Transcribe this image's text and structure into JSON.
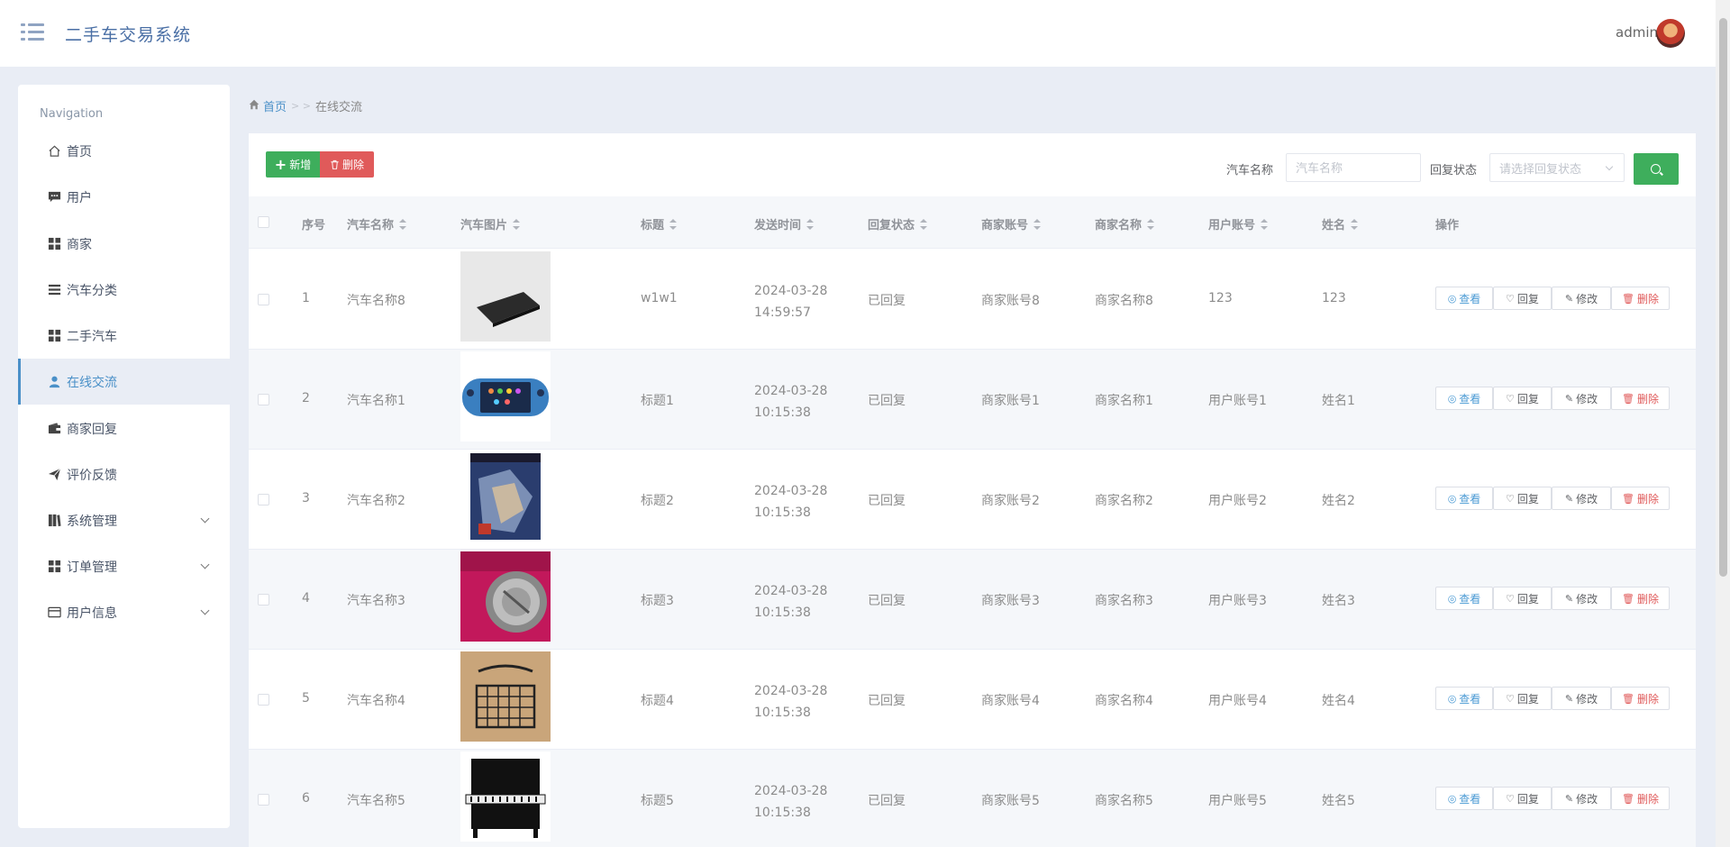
{
  "header": {
    "app_title": "二手车交易系统",
    "user_name": "admin"
  },
  "sidebar": {
    "heading": "Navigation",
    "items": [
      {
        "label": "首页",
        "icon": "home-icon"
      },
      {
        "label": "用户",
        "icon": "chat-icon"
      },
      {
        "label": "商家",
        "icon": "grid-icon"
      },
      {
        "label": "汽车分类",
        "icon": "list-icon"
      },
      {
        "label": "二手汽车",
        "icon": "grid-icon"
      },
      {
        "label": "在线交流",
        "icon": "user-icon",
        "active": true
      },
      {
        "label": "商家回复",
        "icon": "wallet-icon"
      },
      {
        "label": "评价反馈",
        "icon": "send-icon"
      },
      {
        "label": "系统管理",
        "icon": "book-icon",
        "expandable": true
      },
      {
        "label": "订单管理",
        "icon": "grid-icon",
        "expandable": true
      },
      {
        "label": "用户信息",
        "icon": "card-icon",
        "expandable": true
      }
    ]
  },
  "breadcrumb": {
    "home": "首页",
    "separator": "> >",
    "current": "在线交流"
  },
  "toolbar": {
    "add_label": "新增",
    "delete_label": "删除"
  },
  "search": {
    "car_name_label": "汽车名称",
    "car_name_placeholder": "汽车名称",
    "reply_status_label": "回复状态",
    "reply_status_placeholder": "请选择回复状态"
  },
  "table": {
    "columns": [
      "序号",
      "汽车名称",
      "汽车图片",
      "标题",
      "发送时间",
      "回复状态",
      "商家账号",
      "商家名称",
      "用户账号",
      "姓名",
      "操作"
    ],
    "rows": [
      {
        "no": "1",
        "car_name": "汽车名称8",
        "image": "laptop",
        "title": "w1w1",
        "time": "2024-03-28 14:59:57",
        "status": "已回复",
        "merchant_account": "商家账号8",
        "merchant_name": "商家名称8",
        "user_account": "123",
        "name": "123"
      },
      {
        "no": "2",
        "car_name": "汽车名称1",
        "image": "game-console",
        "title": "标题1",
        "time": "2024-03-28 10:15:38",
        "status": "已回复",
        "merchant_account": "商家账号1",
        "merchant_name": "商家名称1",
        "user_account": "用户账号1",
        "name": "姓名1"
      },
      {
        "no": "3",
        "car_name": "汽车名称2",
        "image": "game-box",
        "title": "标题2",
        "time": "2024-03-28 10:15:38",
        "status": "已回复",
        "merchant_account": "商家账号2",
        "merchant_name": "商家名称2",
        "user_account": "用户账号2",
        "name": "姓名2"
      },
      {
        "no": "4",
        "car_name": "汽车名称3",
        "image": "camera",
        "title": "标题3",
        "time": "2024-03-28 10:15:38",
        "status": "已回复",
        "merchant_account": "商家账号3",
        "merchant_name": "商家名称3",
        "user_account": "用户账号3",
        "name": "姓名3"
      },
      {
        "no": "5",
        "car_name": "汽车名称4",
        "image": "basket",
        "title": "标题4",
        "time": "2024-03-28 10:15:38",
        "status": "已回复",
        "merchant_account": "商家账号4",
        "merchant_name": "商家名称4",
        "user_account": "用户账号4",
        "name": "姓名4"
      },
      {
        "no": "6",
        "car_name": "汽车名称5",
        "image": "piano",
        "title": "标题5",
        "time": "2024-03-28 10:15:38",
        "status": "已回复",
        "merchant_account": "商家账号5",
        "merchant_name": "商家名称5",
        "user_account": "用户账号5",
        "name": "姓名5"
      }
    ],
    "actions": {
      "view": "查看",
      "reply": "回复",
      "edit": "修改",
      "delete": "删除"
    }
  },
  "colors": {
    "primary": "#4a90c8",
    "success": "#3eae5c",
    "danger": "#e05a5a"
  }
}
